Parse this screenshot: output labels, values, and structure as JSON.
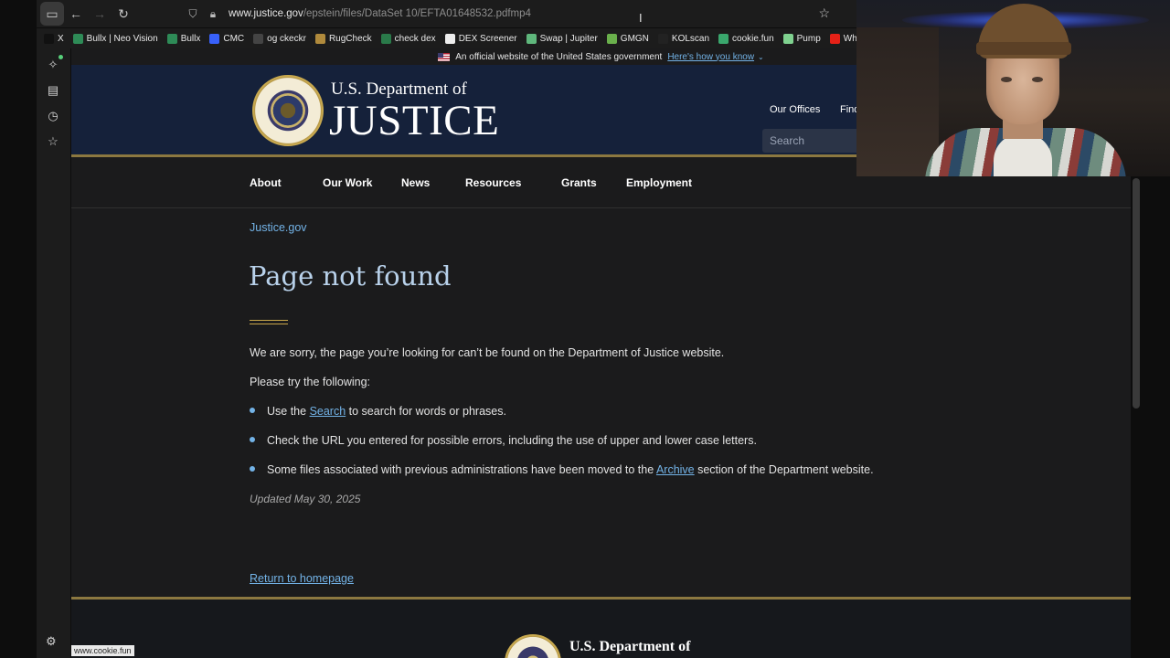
{
  "browser": {
    "url_host": "www.justice.gov",
    "url_path": "/epstein/files/DataSet 10/EFTA01648532.pdfmp4",
    "status_url": "www.cookie.fun"
  },
  "bookmarks": [
    {
      "label": "X",
      "icon": "x-logo-icon",
      "color": "#111111"
    },
    {
      "label": "Bullx | Neo Vision",
      "icon": "bullx-icon",
      "color": "#2e8b57"
    },
    {
      "label": "Bullx",
      "icon": "bullx-icon",
      "color": "#2e8b57"
    },
    {
      "label": "CMC",
      "icon": "cmc-icon",
      "color": "#3861fb"
    },
    {
      "label": "og ckeckr",
      "icon": "globe-icon",
      "color": "#444444"
    },
    {
      "label": "RugCheck",
      "icon": "rugcheck-icon",
      "color": "#b08a3c"
    },
    {
      "label": "check dex",
      "icon": "dex-icon",
      "color": "#2a7a4a"
    },
    {
      "label": "DEX Screener",
      "icon": "dexscreener-icon",
      "color": "#eeeeee"
    },
    {
      "label": "Swap | Jupiter",
      "icon": "jupiter-icon",
      "color": "#5fb77c"
    },
    {
      "label": "GMGN",
      "icon": "gmgn-icon",
      "color": "#6ab04c"
    },
    {
      "label": "KOLscan",
      "icon": "kolscan-icon",
      "color": "#222222"
    },
    {
      "label": "cookie.fun",
      "icon": "cookie-icon",
      "color": "#3aa76d"
    },
    {
      "label": "Pump",
      "icon": "pill-icon",
      "color": "#7fd18f"
    },
    {
      "label": "Why You S",
      "icon": "youtube-icon",
      "color": "#e62117"
    }
  ],
  "site": {
    "banner_text": "An official website of the United States government",
    "banner_link": "Here's how you know",
    "dept_small": "U.S. Department of",
    "dept_big": "JUSTICE",
    "util_links": [
      "Our Offices",
      "Find"
    ],
    "search_placeholder": "Search",
    "nav": [
      "About",
      "Our Work",
      "News",
      "Resources",
      "Grants",
      "Employment"
    ]
  },
  "content": {
    "breadcrumb": "Justice.gov",
    "title": "Page not found",
    "intro": "We are sorry, the page you’re looking for can’t be found on the Department of Justice website.",
    "try": "Please try the following:",
    "b1_pre": "Use the ",
    "b1_link": "Search",
    "b1_post": " to search for words or phrases.",
    "b2": "Check the URL you entered for possible errors, including the use of upper and lower case letters.",
    "b3_pre": "Some files associated with previous administrations have been moved to the ",
    "b3_link": "Archive",
    "b3_post": " section of the Department website.",
    "updated": "Updated May 30, 2025",
    "home_link": "Return to homepage",
    "footer_dept": "U.S. Department of"
  },
  "colors": {
    "masthead": "#15213a",
    "gold": "#8c7840",
    "link": "#73b3e7",
    "heading": "#b8d1ea"
  }
}
